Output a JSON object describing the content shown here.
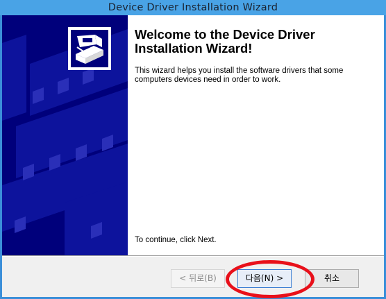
{
  "window": {
    "title": "Device Driver Installation Wizard"
  },
  "banner": {
    "icon": "installer-box-icon",
    "background_color": "#00007b"
  },
  "content": {
    "heading": "Welcome to the Device Driver Installation Wizard!",
    "description": "This wizard helps you install the software drivers that some computers devices need in order to work.",
    "continue_hint": "To continue, click Next."
  },
  "buttons": {
    "back_label": "< 뒤로(B)",
    "next_label": "다음(N) >",
    "cancel_label": "취소"
  },
  "annotation": {
    "highlight_color": "#e8101a"
  }
}
